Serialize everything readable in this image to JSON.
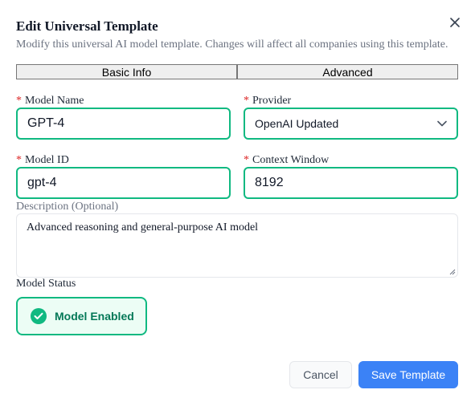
{
  "dialog": {
    "title": "Edit Universal Template",
    "subtitle": "Modify this universal AI model template. Changes will affect all companies using this template.",
    "close_icon": "close-icon"
  },
  "tabs": [
    {
      "label": "Basic Info"
    },
    {
      "label": "Advanced"
    }
  ],
  "form": {
    "required_marker": "*",
    "model_name": {
      "label": "Model Name",
      "value": "GPT-4"
    },
    "provider": {
      "label": "Provider",
      "value": "OpenAI Updated",
      "icon": "chevron-down-icon"
    },
    "model_id": {
      "label": "Model ID",
      "value": "gpt-4"
    },
    "context_window": {
      "label": "Context Window",
      "value": "8192"
    },
    "description": {
      "label": "Description (Optional)",
      "value": "Advanced reasoning and general-purpose AI model"
    },
    "model_status": {
      "label": "Model Status",
      "toggle_label": "Model Enabled",
      "icon": "check-circle-icon"
    }
  },
  "actions": {
    "cancel_label": "Cancel",
    "save_label": "Save Template"
  },
  "colors": {
    "accent_green": "#10b981",
    "primary_blue": "#3b82f6",
    "required_red": "#dc2626"
  }
}
